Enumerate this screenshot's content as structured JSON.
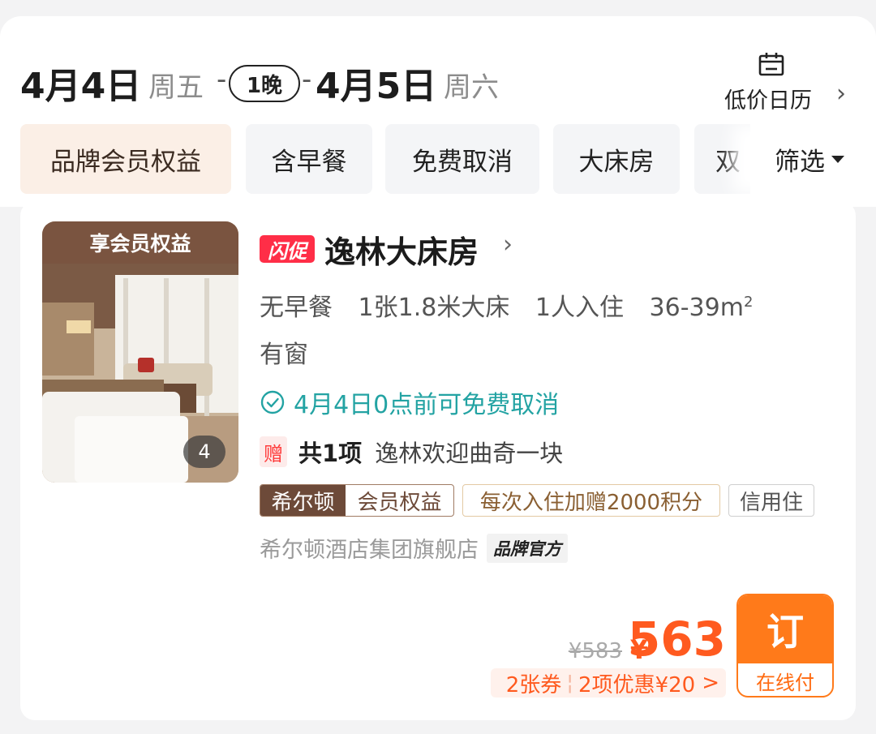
{
  "header": {
    "checkin_date": "4月4日",
    "checkin_weekday": "周五",
    "nights": "1晚",
    "checkout_date": "4月5日",
    "checkout_weekday": "周六",
    "calendar_label": "低价日历"
  },
  "filters": {
    "chips": [
      "品牌会员权益",
      "含早餐",
      "免费取消",
      "大床房",
      "双"
    ],
    "filter_label": "筛选"
  },
  "room": {
    "photo_tag": "享会员权益",
    "photo_count": "4",
    "flash_badge": "闪促",
    "title": "逸林大床房",
    "specs": {
      "breakfast": "无早餐",
      "bed": "1张1.8米大床",
      "occupancy": "1人入住",
      "area": "36-39m",
      "area_sup": "2"
    },
    "window": "有窗",
    "cancel_policy": "4月4日0点前可免费取消",
    "gift": {
      "badge": "赠",
      "count": "共1项",
      "item": "逸林欢迎曲奇一块"
    },
    "tags": {
      "brand": "希尔顿",
      "member": "会员权益",
      "points": "每次入住加赠2000积分",
      "credit": "信用住"
    },
    "store": "希尔顿酒店集团旗舰店",
    "store_badge": "品牌官方"
  },
  "price": {
    "original": "¥583",
    "currency": "¥",
    "current": "563",
    "coupons": "2张券",
    "discount": "2项优惠¥20",
    "discount_arrow": ">"
  },
  "booking": {
    "button_label": "订",
    "pay_mode": "在线付"
  },
  "colors": {
    "accent_orange": "#ff7a1a",
    "price_orange": "#ff5a1f",
    "flash_red": "#ff2e47",
    "cancel_teal": "#23a3a3",
    "brand_brown": "#6d4a39"
  }
}
